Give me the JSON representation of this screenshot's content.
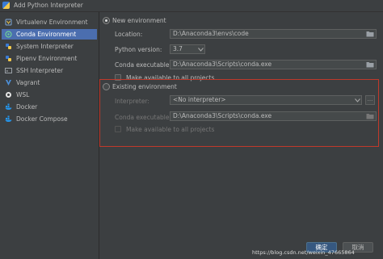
{
  "window": {
    "title": "Add Python Interpreter"
  },
  "sidebar": {
    "items": [
      {
        "label": "Virtualenv Environment",
        "icon": "virtualenv-icon"
      },
      {
        "label": "Conda Environment",
        "icon": "conda-icon",
        "selected": true
      },
      {
        "label": "System Interpreter",
        "icon": "python-icon"
      },
      {
        "label": "Pipenv Environment",
        "icon": "pipenv-icon"
      },
      {
        "label": "SSH Interpreter",
        "icon": "ssh-icon"
      },
      {
        "label": "Vagrant",
        "icon": "vagrant-icon"
      },
      {
        "label": "WSL",
        "icon": "wsl-icon"
      },
      {
        "label": "Docker",
        "icon": "docker-icon"
      },
      {
        "label": "Docker Compose",
        "icon": "docker-compose-icon"
      }
    ]
  },
  "new_env": {
    "radio_label": "New environment",
    "location_label": "Location:",
    "location_value": "D:\\Anaconda3\\envs\\code",
    "python_version_label": "Python version:",
    "python_version_value": "3.7",
    "conda_exec_label": "Conda executable:",
    "conda_exec_value": "D:\\Anaconda3\\Scripts\\conda.exe",
    "make_available_label": "Make available to all projects"
  },
  "existing_env": {
    "radio_label": "Existing environment",
    "interpreter_label": "Interpreter:",
    "interpreter_value": "<No interpreter>",
    "ellipsis": "...",
    "conda_exec_label": "Conda executable:",
    "conda_exec_value": "D:\\Anaconda3\\Scripts\\conda.exe",
    "make_available_label": "Make available to all projects"
  },
  "buttons": {
    "ok_label": "确定",
    "cancel_label": "取消"
  },
  "watermark": "https://blog.csdn.net/weixin_47665864",
  "colors": {
    "selected": "#4b6eaf",
    "highlight_box": "#c0392b",
    "primary_button": "#365880"
  }
}
